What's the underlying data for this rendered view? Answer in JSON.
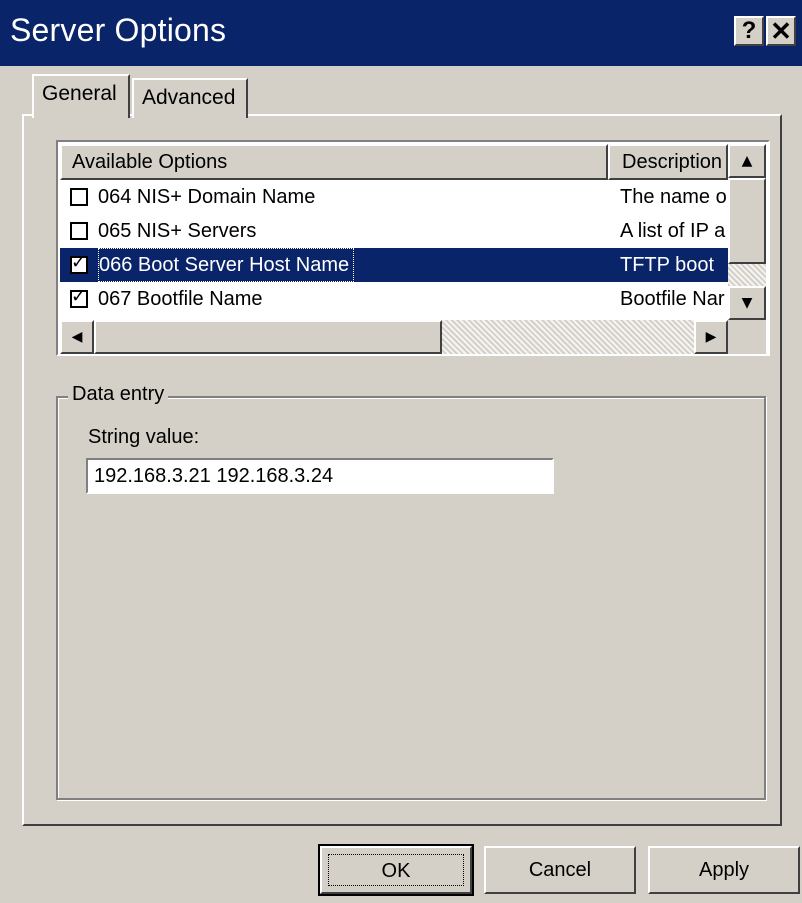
{
  "window": {
    "title": "Server Options",
    "help_button": "?",
    "close_button": "✕"
  },
  "tabs": [
    {
      "label": "General",
      "active": true
    },
    {
      "label": "Advanced",
      "active": false
    }
  ],
  "list": {
    "columns": [
      "Available Options",
      "Description"
    ],
    "rows": [
      {
        "checked": false,
        "name": "064 NIS+ Domain Name",
        "description": "The name o",
        "selected": false
      },
      {
        "checked": false,
        "name": "065 NIS+ Servers",
        "description": "A list of IP a",
        "selected": false
      },
      {
        "checked": true,
        "name": "066 Boot Server Host Name",
        "description": "TFTP boot",
        "selected": true
      },
      {
        "checked": true,
        "name": "067 Bootfile Name",
        "description": "Bootfile Nar",
        "selected": false
      }
    ]
  },
  "data_entry": {
    "legend": "Data entry",
    "label": "String value:",
    "value": "192.168.3.21 192.168.3.24"
  },
  "buttons": {
    "ok": "OK",
    "cancel": "Cancel",
    "apply": "Apply"
  }
}
